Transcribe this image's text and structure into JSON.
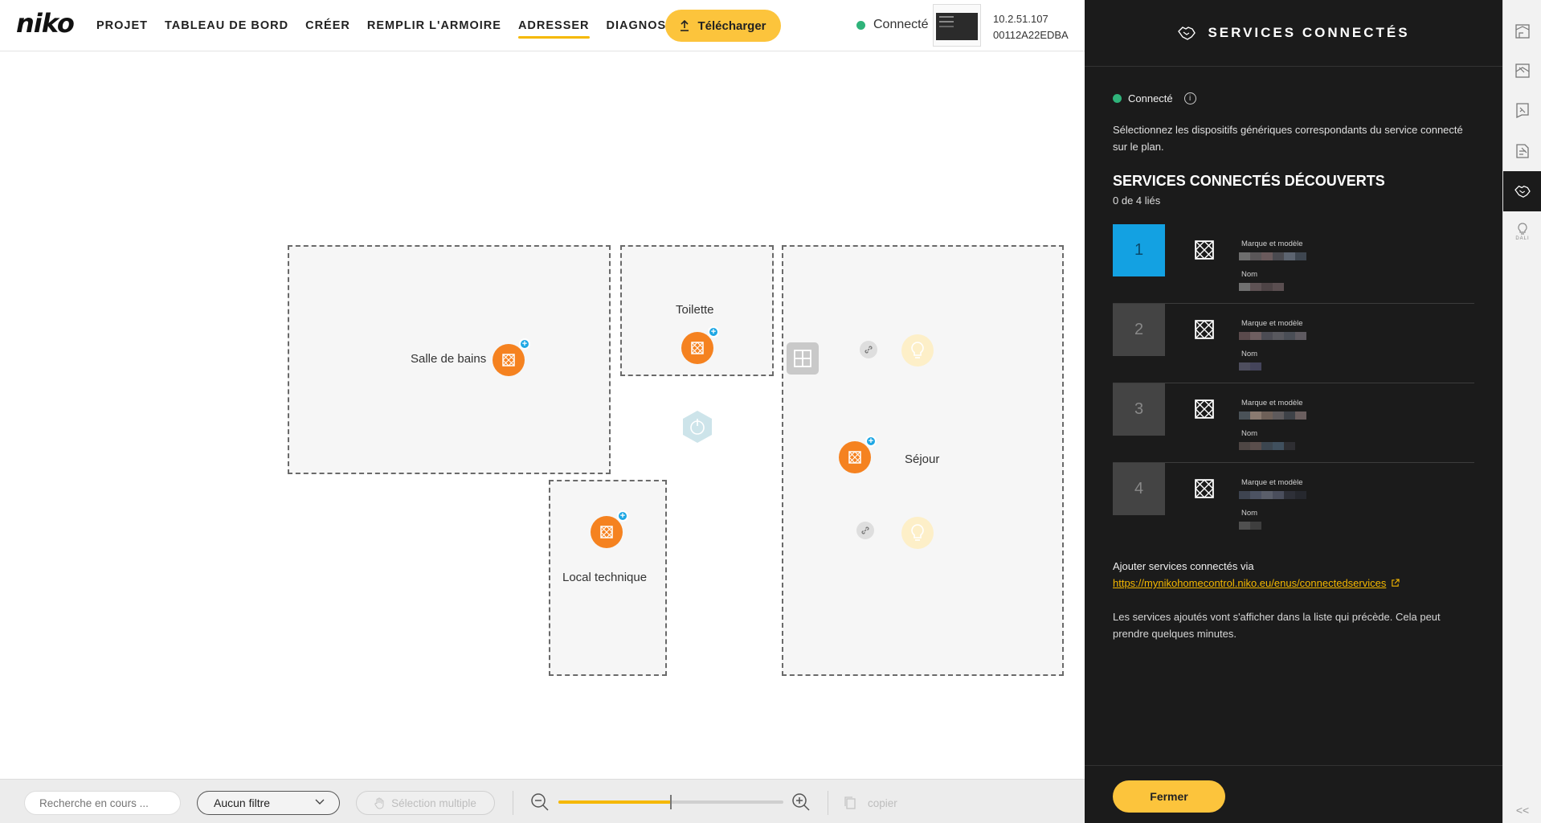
{
  "app": {
    "logo": "niko",
    "nav": [
      {
        "label": "PROJET"
      },
      {
        "label": "TABLEAU DE BORD"
      },
      {
        "label": "CRÉER"
      },
      {
        "label": "REMPLIR L'ARMOIRE"
      },
      {
        "label": "ADRESSER",
        "active": true
      },
      {
        "label": "DIAGNOSTIC",
        "external": true
      }
    ],
    "download_label": "Télécharger",
    "connection_status": "Connecté",
    "device_ip": "10.2.51.107",
    "device_id": "00112A22EDBA",
    "accent_color": "#fcc43c",
    "status_color": "#2fb37a"
  },
  "floorplan": {
    "rooms": [
      {
        "label": "Salle de bains"
      },
      {
        "label": "Toilette"
      },
      {
        "label": "Local technique"
      },
      {
        "label": "Séjour"
      }
    ],
    "device_icons": [
      "connected-service-icon",
      "power-hexagon-icon",
      "socket-icon",
      "link-icon",
      "bulb-icon"
    ]
  },
  "toolbar": {
    "search_placeholder": "Recherche en cours ...",
    "filter_value": "Aucun filtre",
    "multi_select_label": "Sélection multiple",
    "zoom_level": 0.5,
    "copy_label": "copier"
  },
  "panel": {
    "title": "SERVICES CONNECTÉS",
    "status": "Connecté",
    "description": "Sélectionnez les dispositifs génériques correspondants du service connecté sur le plan.",
    "discovered_title": "SERVICES CONNECTÉS DÉCOUVERTS",
    "linked_count": "0 de 4 liés",
    "services": [
      {
        "number": "1",
        "brand_label": "Marque et modèle",
        "name_label": "Nom",
        "selected": true
      },
      {
        "number": "2",
        "brand_label": "Marque et modèle",
        "name_label": "Nom",
        "selected": false
      },
      {
        "number": "3",
        "brand_label": "Marque et modèle",
        "name_label": "Nom",
        "selected": false
      },
      {
        "number": "4",
        "brand_label": "Marque et modèle",
        "name_label": "Nom",
        "selected": false
      }
    ],
    "add_via_label": "Ajouter services connectés via",
    "add_via_link": "https://mynikohomecontrol.niko.eu/enus/connectedservices",
    "note": "Les services ajoutés vont s'afficher dans la liste qui précède. Cela peut prendre quelques minutes.",
    "close_label": "Fermer",
    "selected_color": "#13a1e2"
  },
  "rail": {
    "dali_label": "DALI",
    "collapse_label": "<<"
  }
}
